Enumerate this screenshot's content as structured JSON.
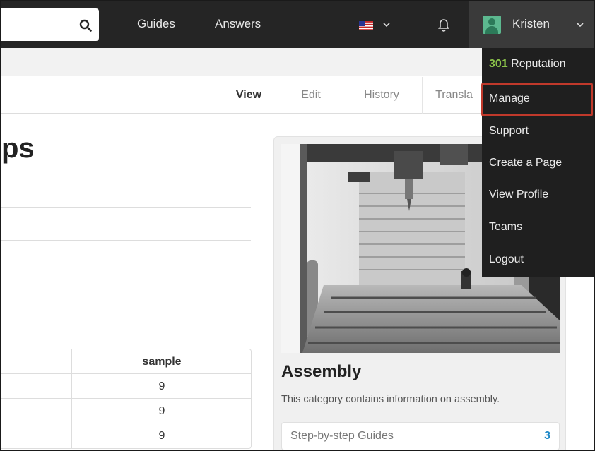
{
  "header": {
    "nav_links": [
      "Guides",
      "Answers"
    ],
    "user_name": "Kristen"
  },
  "tabs": [
    "View",
    "Edit",
    "History",
    "Transla"
  ],
  "page": {
    "title_fragment": "ps",
    "table": {
      "header": "sample",
      "values": [
        "9",
        "9",
        "9"
      ]
    }
  },
  "card": {
    "title": "Assembly",
    "description": "This category contains information on assembly.",
    "guides_label": "Step-by-step Guides",
    "guides_count": "3"
  },
  "user_menu": {
    "reputation_value": "301",
    "reputation_label": "Reputation",
    "items": [
      "Manage",
      "Support",
      "Create a Page",
      "View Profile",
      "Teams",
      "Logout"
    ],
    "highlighted_item": "Manage"
  },
  "colors": {
    "nav_bg": "#252525",
    "reputation": "#8bc34a",
    "highlight_box": "#c0392b",
    "count_link": "#1e88c7"
  }
}
